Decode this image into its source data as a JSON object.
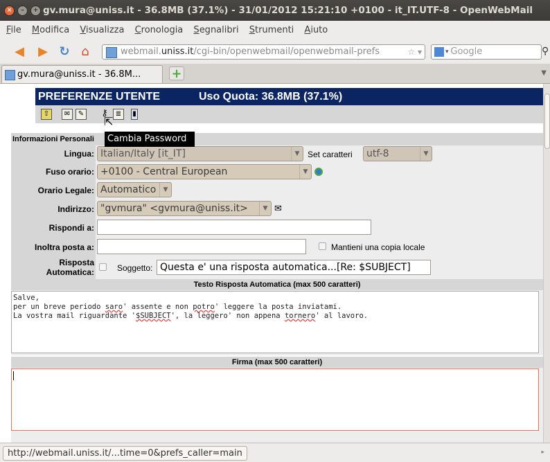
{
  "window": {
    "title": "gv.mura@uniss.it - 36.8MB (37.1%) - 31/01/2012 15:21:10 +0100 - it_IT.UTF-8 - OpenWebMail"
  },
  "menu": [
    "File",
    "Modifica",
    "Visualizza",
    "Cronologia",
    "Segnalibri",
    "Strumenti",
    "Aiuto"
  ],
  "nav": {
    "url_prefix": "webmail.",
    "url_host": "uniss.it",
    "url_rest": "/cgi-bin/openwebmail/openwebmail-prefs",
    "search_placeholder": "Google"
  },
  "tab": {
    "label": "gv.mura@uniss.it - 36.8M..."
  },
  "header": {
    "title": "PREFERENZE UTENTE",
    "quota": "Uso Quota: 36.8MB (37.1%)"
  },
  "tooltip": "Cambia Password",
  "section": {
    "title": "Informazioni Personali"
  },
  "fields": {
    "lingua_label": "Lingua:",
    "lingua_value": "Italian/Italy [it_IT]",
    "charset_label": "Set caratteri",
    "charset_value": "utf-8",
    "fuso_label": "Fuso orario:",
    "fuso_value": "+0100 - Central European",
    "legale_label": "Orario Legale:",
    "legale_value": "Automatico",
    "indirizzo_label": "Indirizzo:",
    "indirizzo_value": "\"gvmura\" <gvmura@uniss.it>",
    "rispondi_label": "Rispondi a:",
    "rispondi_value": "",
    "inoltra_label": "Inoltra posta a:",
    "inoltra_value": "",
    "copia_label": "Mantieni una copia locale",
    "risposta_label_1": "Risposta",
    "risposta_label_2": "Automatica:",
    "soggetto_label": "Soggetto:",
    "soggetto_value": "Questa e' una risposta automatica...[Re: $SUBJECT]"
  },
  "autoreply": {
    "heading": "Testo Risposta Automatica (max 500 caratteri)",
    "line1": "Salve,",
    "line2a": "per un breve periodo ",
    "line2b": "saro",
    "line2c": "' assente e non ",
    "line2d": "potro",
    "line2e": "' leggere la posta inviatami.",
    "line3a": "La vostra mail riguardante '",
    "line3b": "$SUBJECT",
    "line3c": "', la leggero' non appena ",
    "line3d": "tornero",
    "line3e": "' al lavoro."
  },
  "signature": {
    "heading": "Firma (max 500 caratteri)",
    "value": ""
  },
  "status": {
    "text": "http://webmail.uniss.it/...time=0&prefs_caller=main"
  }
}
